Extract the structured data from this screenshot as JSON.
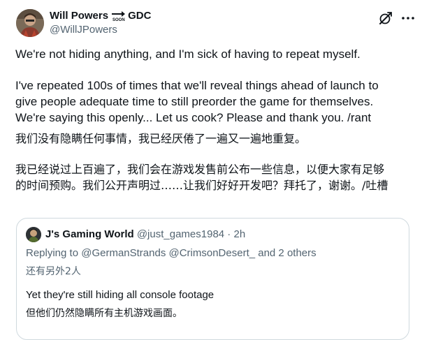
{
  "tweet": {
    "display_name": "Will Powers",
    "name_emoji_label": "SOON",
    "name_suffix": "GDC",
    "handle": "@WillJPowers",
    "avatar_icon": "user-avatar",
    "actions": {
      "grok_icon": "grok-slash-icon",
      "more_icon": "more-options-icon"
    },
    "text_en_1": "We're not hiding anything, and I'm sick of having to repeat myself.",
    "text_en_2": "I've repeated 100s of times that we'll reveal things ahead of launch to\ngive people adequate time to still preorder the game for themselves.\nWe're saying this openly... Let us cook? Please and thank you. /rant",
    "text_zh_1": "我们没有隐瞒任何事情，我已经厌倦了一遍又一遍地重复。",
    "text_zh_2": "我已经说过上百遍了，我们会在游戏发售前公布一些信息，以便大家有足够\n的时间预购。我们公开声明过……让我们好好开发吧？拜托了，谢谢。/吐槽"
  },
  "quoted_tweet": {
    "display_name": "J's Gaming World",
    "handle": "@just_games1984",
    "separator": " · ",
    "time": "2h",
    "replying_to": "Replying to @GermanStrands @CrimsonDesert_ and 2 others",
    "replying_to_zh": "还有另外2人",
    "text_en": "Yet they're still hiding all console footage",
    "text_zh": "但他们仍然隐瞒所有主机游戏画面。"
  },
  "colors": {
    "text_primary": "#0f1419",
    "text_secondary": "#536471",
    "border": "#cfd9de",
    "background": "#ffffff"
  }
}
